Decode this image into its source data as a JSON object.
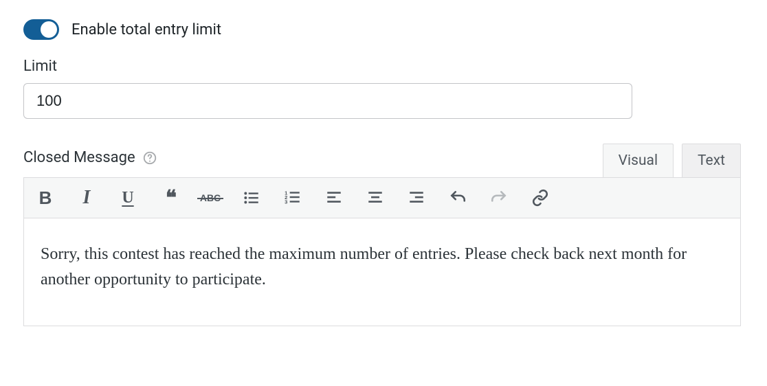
{
  "toggle": {
    "label": "Enable total entry limit",
    "enabled": true
  },
  "limit": {
    "label": "Limit",
    "value": "100"
  },
  "closedMessage": {
    "label": "Closed Message",
    "tabs": {
      "visual": "Visual",
      "text": "Text"
    },
    "content": "Sorry, this contest has reached the maximum number of entries. Please check back next month for another opportunity to participate."
  },
  "toolbar": {
    "bold": "B",
    "italic": "I",
    "underline": "U",
    "strike": "ABC"
  }
}
